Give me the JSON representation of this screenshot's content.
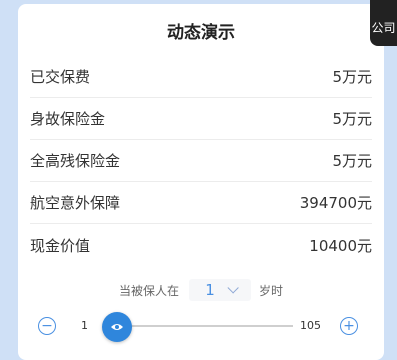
{
  "title": "动态演示",
  "rows": [
    {
      "label": "已交保费",
      "value": "5万元"
    },
    {
      "label": "身故保险金",
      "value": "5万元"
    },
    {
      "label": "全高残保险金",
      "value": "5万元"
    },
    {
      "label": "航空意外保障",
      "value": "394700元"
    },
    {
      "label": "现金价值",
      "value": "10400元"
    }
  ],
  "age": {
    "prefix": "当被保人在",
    "value": "1",
    "suffix": "岁时"
  },
  "slider": {
    "min_label": "1",
    "max_label": "105",
    "min_icon": "−",
    "max_icon": "+",
    "current": 1
  },
  "side_tab": {
    "text": "公司"
  }
}
